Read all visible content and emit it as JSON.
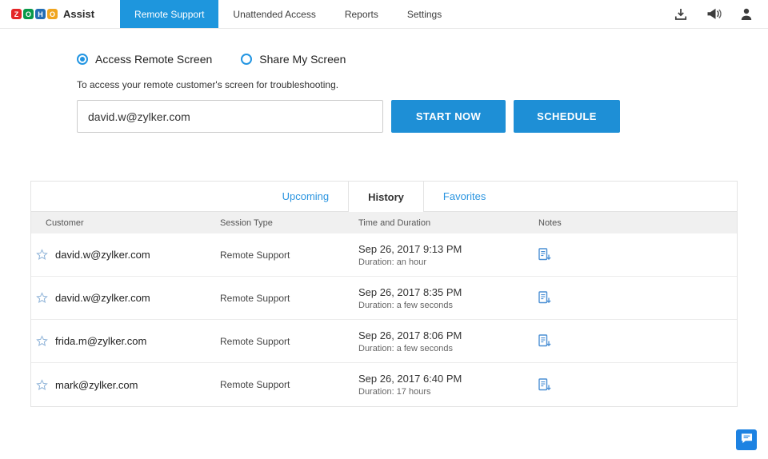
{
  "colors": {
    "accent_blue": "#1e96dd",
    "button_blue": "#1e8fd6",
    "chat_blue": "#1d82e2"
  },
  "header": {
    "logo_letters": [
      "Z",
      "O",
      "H",
      "O"
    ],
    "product": "Assist",
    "tabs": [
      {
        "label": "Remote Support",
        "active": true
      },
      {
        "label": "Unattended Access",
        "active": false
      },
      {
        "label": "Reports",
        "active": false
      },
      {
        "label": "Settings",
        "active": false
      }
    ],
    "icons": [
      "download-icon",
      "announcement-icon",
      "user-icon"
    ]
  },
  "session": {
    "options": [
      {
        "label": "Access Remote Screen",
        "selected": true
      },
      {
        "label": "Share My Screen",
        "selected": false
      }
    ],
    "description": "To access your remote customer's screen for troubleshooting.",
    "email_value": "david.w@zylker.com",
    "start_label": "START NOW",
    "schedule_label": "SCHEDULE"
  },
  "history": {
    "tabs": [
      {
        "label": "Upcoming",
        "active": false
      },
      {
        "label": "History",
        "active": true
      },
      {
        "label": "Favorites",
        "active": false
      }
    ],
    "columns": [
      "Customer",
      "Session Type",
      "Time and Duration",
      "Notes"
    ],
    "rows": [
      {
        "customer": "david.w@zylker.com",
        "session_type": "Remote Support",
        "time": "Sep 26, 2017 9:13 PM",
        "duration": "Duration: an hour"
      },
      {
        "customer": "david.w@zylker.com",
        "session_type": "Remote Support",
        "time": "Sep 26, 2017 8:35 PM",
        "duration": "Duration: a few seconds"
      },
      {
        "customer": "frida.m@zylker.com",
        "session_type": "Remote Support",
        "time": "Sep 26, 2017 8:06 PM",
        "duration": "Duration: a few seconds"
      },
      {
        "customer": "mark@zylker.com",
        "session_type": "Remote Support",
        "time": "Sep 26, 2017 6:40 PM",
        "duration": "Duration: 17 hours"
      }
    ]
  }
}
